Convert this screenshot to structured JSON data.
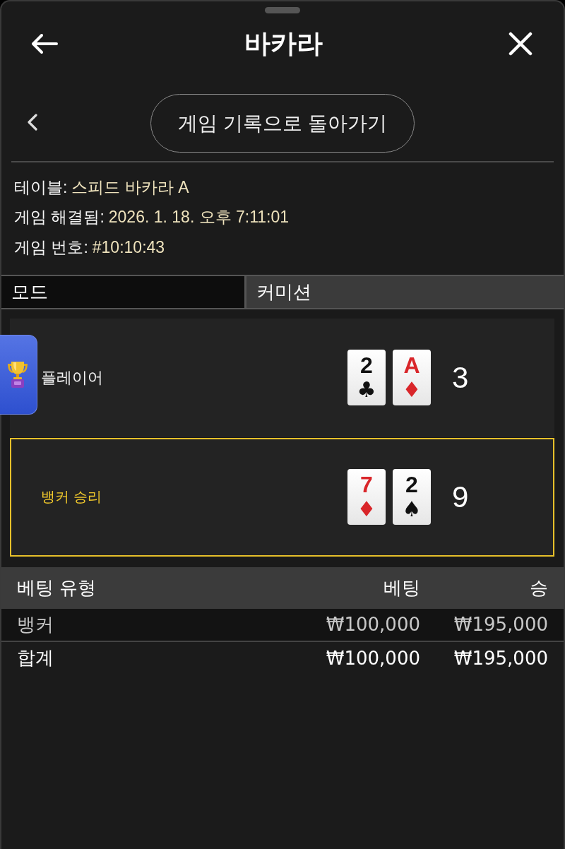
{
  "sheet": {
    "title": "바카라"
  },
  "nav": {
    "back_button": "게임 기록으로 돌아가기"
  },
  "info": [
    {
      "label": "테이블:",
      "value": "스피드 바카라 A"
    },
    {
      "label": "게임 해결됨:",
      "value": "2026. 1. 18. 오후 7:11:01"
    },
    {
      "label": "게임 번호:",
      "value": "#10:10:43"
    }
  ],
  "mode": {
    "label": "모드",
    "value": "커미션"
  },
  "hands": [
    {
      "label": "플레이어",
      "winner": false,
      "cards": [
        {
          "rank": "2",
          "suit": "♣",
          "color": "#111111"
        },
        {
          "rank": "A",
          "suit": "♦",
          "color": "#d9262a"
        }
      ],
      "score": "3"
    },
    {
      "label": "뱅커 승리",
      "winner": true,
      "cards": [
        {
          "rank": "7",
          "suit": "♦",
          "color": "#d9262a"
        },
        {
          "rank": "2",
          "suit": "♠",
          "color": "#111111"
        }
      ],
      "score": "9"
    }
  ],
  "bets": {
    "columns": [
      "베팅 유형",
      "베팅",
      "승"
    ],
    "rows": [
      {
        "cells": [
          "뱅커",
          "₩100,000",
          "₩195,000"
        ]
      }
    ],
    "total": {
      "cells": [
        "합계",
        "₩100,000",
        "₩195,000"
      ]
    }
  }
}
